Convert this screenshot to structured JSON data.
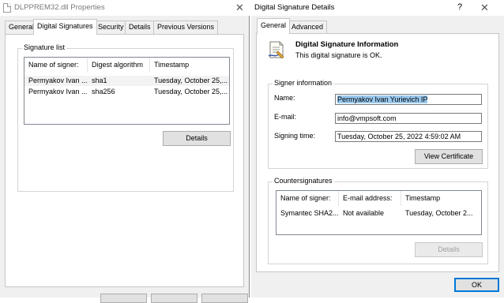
{
  "left": {
    "title": "DLPPREM32.dll Properties",
    "close_glyph": "✕",
    "tabs": [
      "General",
      "Digital Signatures",
      "Security",
      "Details",
      "Previous Versions"
    ],
    "signature_list_label": "Signature list",
    "columns": [
      "Name of signer:",
      "Digest algorithm",
      "Timestamp"
    ],
    "rows": [
      [
        "Permyakov Ivan ...",
        "sha1",
        "Tuesday, October 25,..."
      ],
      [
        "Permyakov Ivan ...",
        "sha256",
        "Tuesday, October 25,..."
      ]
    ],
    "details_button": "Details"
  },
  "right": {
    "title": "Digital Signature Details",
    "help_glyph": "?",
    "close_glyph": "✕",
    "tabs": [
      "General",
      "Advanced"
    ],
    "info_heading": "Digital Signature Information",
    "info_status": "This digital signature is OK.",
    "signer_group_label": "Signer information",
    "name_label": "Name:",
    "name_value": "Permyakov Ivan Yurievich IP",
    "email_label": "E-mail:",
    "email_value": "info@vmpsoft.com",
    "signing_time_label": "Signing time:",
    "signing_time_value": "Tuesday, October 25, 2022 4:59:02 AM",
    "view_certificate_button": "View Certificate",
    "countersig_group_label": "Countersignatures",
    "cs_columns": [
      "Name of signer:",
      "E-mail address:",
      "Timestamp"
    ],
    "cs_rows": [
      [
        "Symantec SHA2...",
        "Not available",
        "Tuesday, October 2..."
      ]
    ],
    "details_button": "Details",
    "ok_button": "OK"
  },
  "colors": {
    "accent": "#0078d7",
    "selection": "#99c9ef"
  }
}
